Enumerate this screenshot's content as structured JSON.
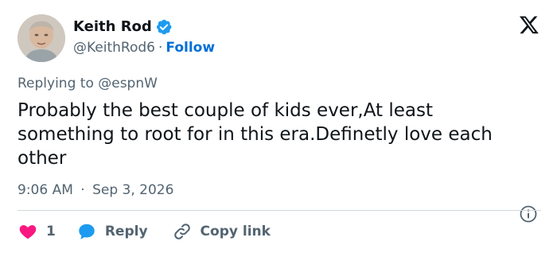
{
  "author": {
    "display_name": "Keith Rod",
    "handle": "@KeithRod6",
    "separator": "·",
    "follow_label": "Follow",
    "verified": true
  },
  "reply_context": {
    "text": "Replying to @espnW"
  },
  "tweet": {
    "text": "Probably the best couple of kids ever,At least something to root for in this era.Definetly love each other"
  },
  "meta": {
    "time": "9:06 AM",
    "separator": "·",
    "date": "Sep 3, 2026"
  },
  "actions": {
    "like_count": "1",
    "reply_label": "Reply",
    "copy_link_label": "Copy link"
  },
  "icons": {
    "verified": "verified-badge-icon",
    "brand": "x-logo-icon",
    "info": "info-icon",
    "like": "heart-icon",
    "reply": "speech-bubble-icon",
    "copy": "link-icon"
  },
  "colors": {
    "text_primary": "#0f1419",
    "text_secondary": "#536471",
    "link_blue": "#006fd6",
    "verified_blue": "#1d9bf0",
    "heart_pink": "#f91880",
    "divider": "#cfd9de"
  }
}
